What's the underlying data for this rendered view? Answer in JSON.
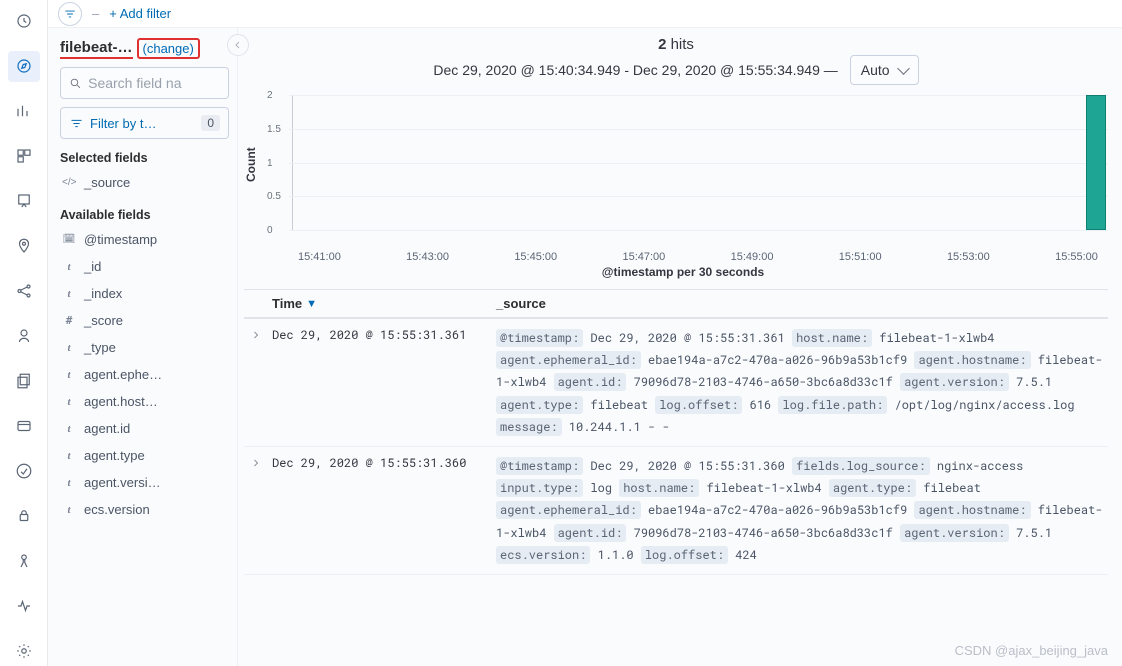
{
  "filterBar": {
    "addFilter": "+ Add filter"
  },
  "sidebar": {
    "indexPattern": "filebeat-…",
    "changeLabel": "(change)",
    "searchPlaceholder": "Search field na",
    "filterByType": "Filter by t…",
    "filterCount": "0",
    "selectedHead": "Selected fields",
    "availableHead": "Available fields",
    "selectedFields": [
      {
        "type": "</>",
        "name": "_source"
      }
    ],
    "availableFields": [
      {
        "type": "date",
        "name": "@timestamp"
      },
      {
        "type": "t",
        "name": "_id"
      },
      {
        "type": "t",
        "name": "_index"
      },
      {
        "type": "#",
        "name": "_score"
      },
      {
        "type": "t",
        "name": "_type"
      },
      {
        "type": "t",
        "name": "agent.ephe…"
      },
      {
        "type": "t",
        "name": "agent.host…"
      },
      {
        "type": "t",
        "name": "agent.id"
      },
      {
        "type": "t",
        "name": "agent.type"
      },
      {
        "type": "t",
        "name": "agent.versi…"
      },
      {
        "type": "t",
        "name": "ecs.version"
      }
    ]
  },
  "hits": {
    "count": "2",
    "label": "hits"
  },
  "timeRange": "Dec 29, 2020 @ 15:40:34.949 - Dec 29, 2020 @ 15:55:34.949 —",
  "intervalSelected": "Auto",
  "chart_data": {
    "type": "bar",
    "title": "",
    "xlabel": "@timestamp per 30 seconds",
    "ylabel": "Count",
    "ylim": [
      0,
      2
    ],
    "yticks": [
      0,
      0.5,
      1,
      1.5,
      2
    ],
    "xticks": [
      "15:41:00",
      "15:43:00",
      "15:45:00",
      "15:47:00",
      "15:49:00",
      "15:51:00",
      "15:53:00",
      "15:55:00"
    ],
    "categories": [
      "15:55:30"
    ],
    "values": [
      2
    ]
  },
  "table": {
    "timeCol": "Time",
    "sourceCol": "_source",
    "rows": [
      {
        "time": "Dec 29, 2020 @ 15:55:31.361",
        "kv": [
          {
            "k": "@timestamp:",
            "v": " Dec 29, 2020 @ 15:55:31.361 "
          },
          {
            "k": "host.name:",
            "v": " filebeat-1-xlwb4 "
          },
          {
            "k": "agent.ephemeral_id:",
            "v": " ebae194a-a7c2-470a-a026-96b9a53b1cf9 "
          },
          {
            "k": "agent.hostname:",
            "v": " filebeat-1-xlwb4 "
          },
          {
            "k": "agent.id:",
            "v": " 79096d78-2103-4746-a650-3bc6a8d33c1f "
          },
          {
            "k": "agent.version:",
            "v": " 7.5.1 "
          },
          {
            "k": "agent.type:",
            "v": " filebeat "
          },
          {
            "k": "log.offset:",
            "v": " 616 "
          },
          {
            "k": "log.file.path:",
            "v": " /opt/log/nginx/access.log "
          },
          {
            "k": "message:",
            "v": " 10.244.1.1 - - "
          }
        ]
      },
      {
        "time": "Dec 29, 2020 @ 15:55:31.360",
        "kv": [
          {
            "k": "@timestamp:",
            "v": " Dec 29, 2020 @ 15:55:31.360 "
          },
          {
            "k": "fields.log_source:",
            "v": " nginx-access "
          },
          {
            "k": "input.type:",
            "v": " log "
          },
          {
            "k": "host.name:",
            "v": " filebeat-1-xlwb4 "
          },
          {
            "k": "agent.type:",
            "v": " filebeat "
          },
          {
            "k": "agent.ephemeral_id:",
            "v": " ebae194a-a7c2-470a-a026-96b9a53b1cf9 "
          },
          {
            "k": "agent.hostname:",
            "v": " filebeat-1-xlwb4 "
          },
          {
            "k": "agent.id:",
            "v": " 79096d78-2103-4746-a650-3bc6a8d33c1f "
          },
          {
            "k": "agent.version:",
            "v": " 7.5.1 "
          },
          {
            "k": "ecs.version:",
            "v": " 1.1.0 "
          },
          {
            "k": "log.offset:",
            "v": " 424 "
          }
        ]
      }
    ]
  },
  "watermark": "CSDN @ajax_beijing_java"
}
